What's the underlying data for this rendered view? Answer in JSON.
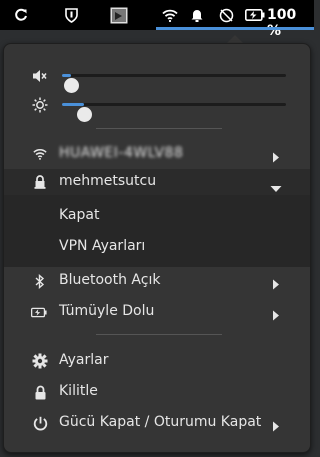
{
  "topbar": {
    "battery_percent": "100 %",
    "icons": [
      "refresh-icon",
      "shield-icon",
      "screen-icon",
      "wifi-icon",
      "notification-bell-icon",
      "do-not-disturb-icon",
      "battery-charging-icon"
    ]
  },
  "sliders": {
    "volume": {
      "icon": "volume-icon",
      "level": 0.04
    },
    "brightness": {
      "icon": "brightness-icon",
      "level": 0.1
    }
  },
  "menu": {
    "wifi": {
      "label": "HUAWEI-4WLV88",
      "icon": "wifi-icon"
    },
    "vpn": {
      "label": "mehmetsutcu",
      "icon": "vpn-lock-icon"
    },
    "vpn_submenu": [
      "Kapat",
      "VPN Ayarları"
    ],
    "bluetooth": {
      "label": "Bluetooth Açık",
      "icon": "bluetooth-icon"
    },
    "battery": {
      "label": "Tümüyle Dolu",
      "icon": "battery-icon"
    },
    "settings": {
      "label": "Ayarlar",
      "icon": "gear-icon"
    },
    "lock": {
      "label": "Kilitle",
      "icon": "lock-icon"
    },
    "power": {
      "label": "Gücü Kapat / Oturumu Kapat",
      "icon": "power-icon"
    }
  },
  "colors": {
    "accent": "#4a90d9",
    "menu_bg": "#353535",
    "submenu_bg": "#272727"
  }
}
